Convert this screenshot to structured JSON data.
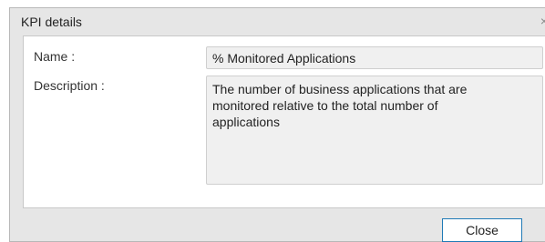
{
  "dialog": {
    "title": "KPI details",
    "close_icon": "×"
  },
  "fields": {
    "name_label": "Name :",
    "name_value": "% Monitored Applications",
    "description_label": "Description :",
    "description_value": "The number of business applications that are\nmonitored relative to the total number of\napplications"
  },
  "footer": {
    "close_button": "Close"
  }
}
